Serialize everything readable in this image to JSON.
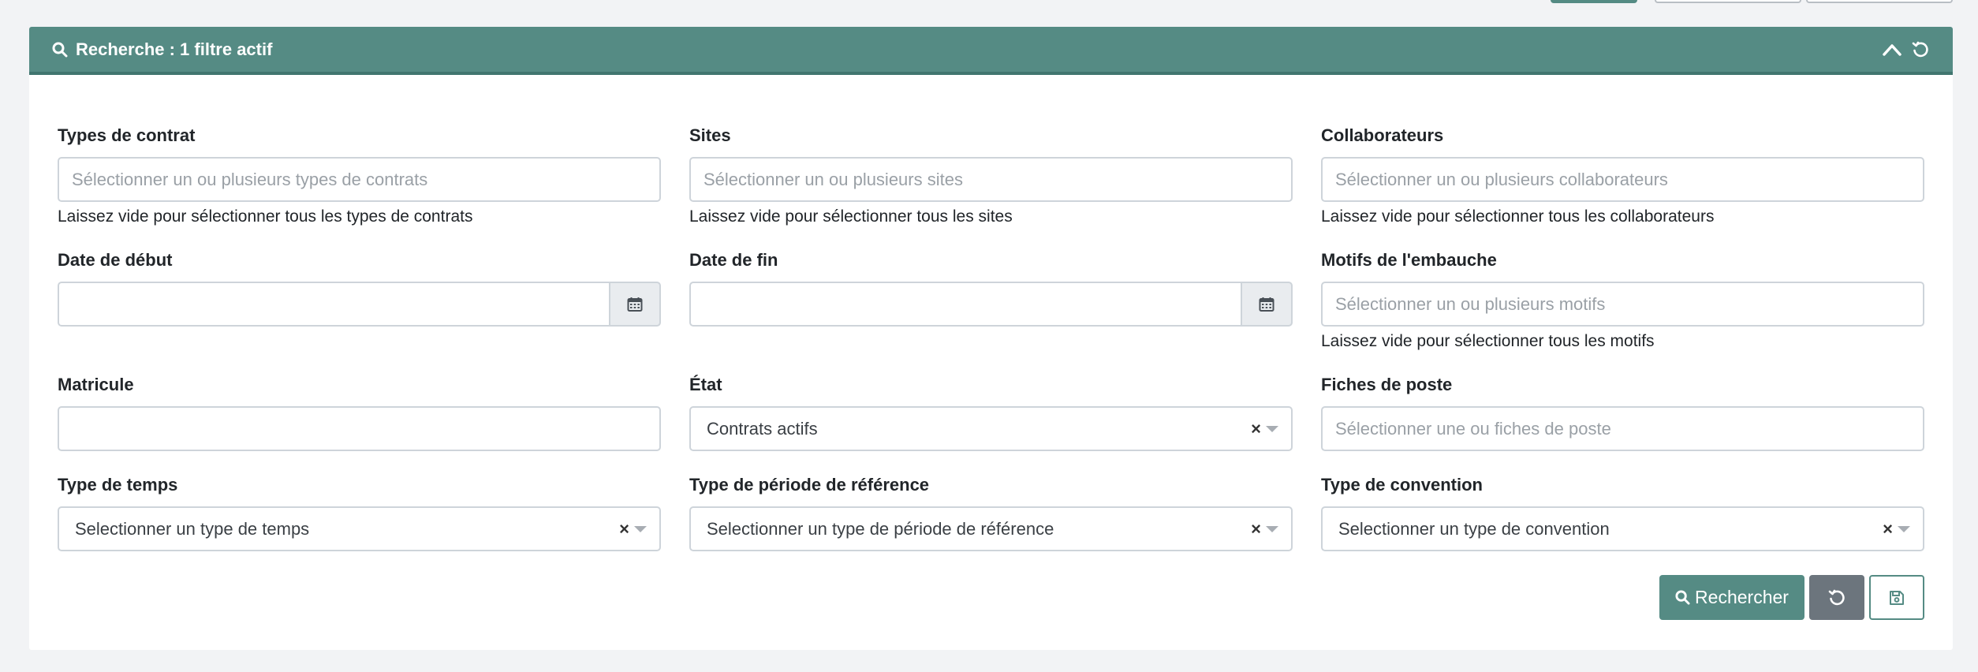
{
  "header": {
    "title": "Recherche : 1 filtre actif",
    "icons": [
      "search-icon",
      "chevron-up-icon",
      "reset-icon"
    ]
  },
  "fields": {
    "contract_types": {
      "label": "Types de contrat",
      "placeholder": "Sélectionner un ou plusieurs types de contrats",
      "help": "Laissez vide pour sélectionner tous les types de contrats"
    },
    "sites": {
      "label": "Sites",
      "placeholder": "Sélectionner un ou plusieurs sites",
      "help": "Laissez vide pour sélectionner tous les sites"
    },
    "collaborators": {
      "label": "Collaborateurs",
      "placeholder": "Sélectionner un ou plusieurs collaborateurs",
      "help": "Laissez vide pour sélectionner tous les collaborateurs"
    },
    "start_date": {
      "label": "Date de début",
      "value": ""
    },
    "end_date": {
      "label": "Date de fin",
      "value": ""
    },
    "hiring_reasons": {
      "label": "Motifs de l'embauche",
      "placeholder": "Sélectionner un ou plusieurs motifs",
      "help": "Laissez vide pour sélectionner tous les motifs"
    },
    "employee_number": {
      "label": "Matricule",
      "value": ""
    },
    "state": {
      "label": "État",
      "value": "Contrats actifs"
    },
    "job_sheets": {
      "label": "Fiches de poste",
      "placeholder": "Sélectionner une ou fiches de poste"
    },
    "time_type": {
      "label": "Type de temps",
      "value": "Selectionner un type de temps"
    },
    "reference_period_type": {
      "label": "Type de période de référence",
      "value": "Selectionner un type de période de référence"
    },
    "convention_type": {
      "label": "Type de convention",
      "value": "Selectionner un type de convention"
    }
  },
  "actions": {
    "search_label": "Rechercher"
  },
  "colors": {
    "primary": "#558b84",
    "secondary": "#6c757d",
    "background": "#f2f3f5"
  }
}
